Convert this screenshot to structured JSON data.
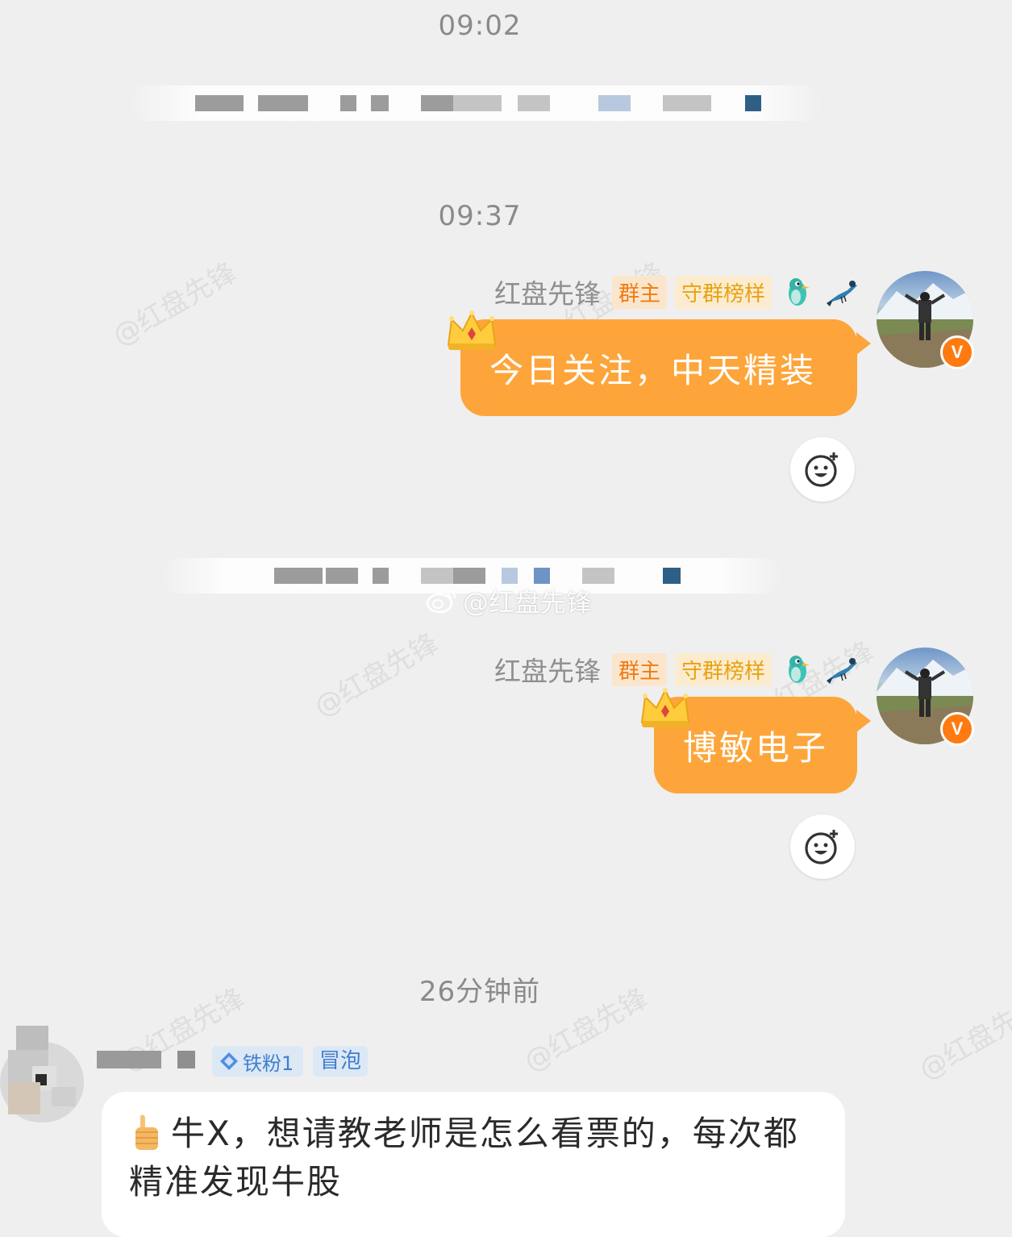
{
  "timestamps": {
    "first": "09:02",
    "second": "09:37",
    "third": "26分钟前"
  },
  "sender": {
    "name": "红盘先锋",
    "badge_owner": "群主",
    "badge_guard": "守群榜样"
  },
  "messages": [
    {
      "text": "今日关注，中天精装"
    },
    {
      "text": "博敏电子"
    }
  ],
  "watermark": {
    "text": "@红盘先锋",
    "weibo_text": "@红盘先锋"
  },
  "incoming": {
    "fan_badge": "铁粉1",
    "bubble_badge": "冒泡",
    "text": "牛X，想请教老师是怎么看票的，每次都精准发现牛股"
  },
  "colors": {
    "bubble_outgoing": "#fda53a",
    "badge_owner": "#f07b10",
    "badge_guard": "#e9a112",
    "fan_badge": "#3e7fd0",
    "background": "#efefef"
  },
  "icons": [
    "crown-icon",
    "bird-icon",
    "magpie-icon",
    "verified-v-icon",
    "emoji-react-icon",
    "weibo-logo-icon",
    "thumbs-up-icon",
    "diamond-icon"
  ]
}
